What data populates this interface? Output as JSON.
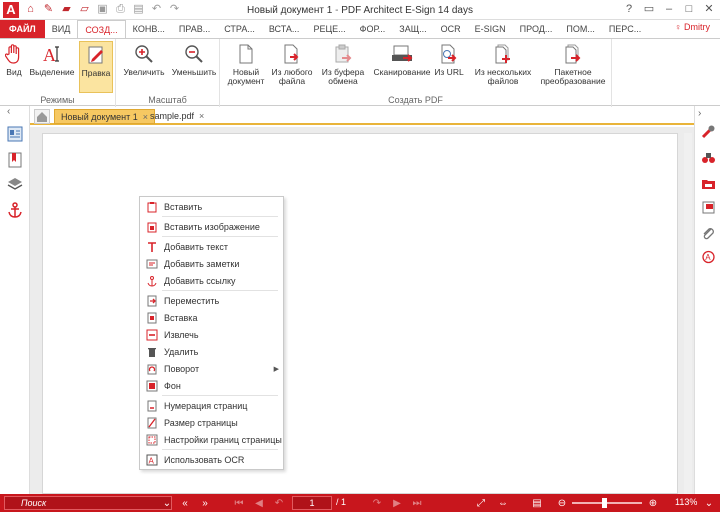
{
  "window": {
    "title_doc": "Новый документ 1",
    "title_sep": "-",
    "title_app": "PDF Architect E-Sign 14 days",
    "logo_letter": "A",
    "user_name": "Dmitry"
  },
  "tabs": [
    "ФАЙЛ",
    "ВИД",
    "СОЗД...",
    "КОНВ...",
    "ПРАВ...",
    "СТРА...",
    "ВСТА...",
    "РЕЦЕ...",
    "ФОР...",
    "ЗАЩ...",
    "OCR",
    "E-SIGN",
    "ПРОД...",
    "ПОМ...",
    "ПЕРС..."
  ],
  "ribbon": {
    "modes": {
      "label": "Режимы",
      "buttons": [
        "Вид",
        "Выделение",
        "Правка"
      ]
    },
    "zoom": {
      "label": "Масштаб",
      "buttons": [
        "Увеличить",
        "Уменьшить"
      ]
    },
    "create": {
      "label": "Создать PDF",
      "new_doc": [
        "Новый",
        "документ"
      ],
      "from_file": [
        "Из любого",
        "файла"
      ],
      "from_clipboard": [
        "Из буфера",
        "обмена"
      ],
      "scan": "Сканирование",
      "from_url": "Из URL",
      "from_multiple": [
        "Из нескольких",
        "файлов"
      ],
      "batch": [
        "Пакетное",
        "преобразование"
      ]
    }
  },
  "doc_tabs": [
    {
      "label": "Новый документ 1",
      "close": "×"
    },
    {
      "label": "sample.pdf",
      "close": "×"
    }
  ],
  "context_menu": [
    "Вставить",
    "Вставить изображение",
    "Добавить текст",
    "Добавить заметки",
    "Добавить ссылку",
    "Переместить",
    "Вставка",
    "Извлечь",
    "Удалить",
    "Поворот",
    "Фон",
    "Нумерация страниц",
    "Размер страницы",
    "Настройки границ страницы",
    "Использовать OCR"
  ],
  "statusbar": {
    "search_placeholder": "Поиск",
    "current_page": "1",
    "total_pages": "/ 1",
    "zoom": "113%",
    "zoom_level_fraction": 0.46
  },
  "colors": {
    "accent": "#d8232a",
    "statusbar": "#c8161d",
    "tab_highlight": "#f6c862"
  }
}
